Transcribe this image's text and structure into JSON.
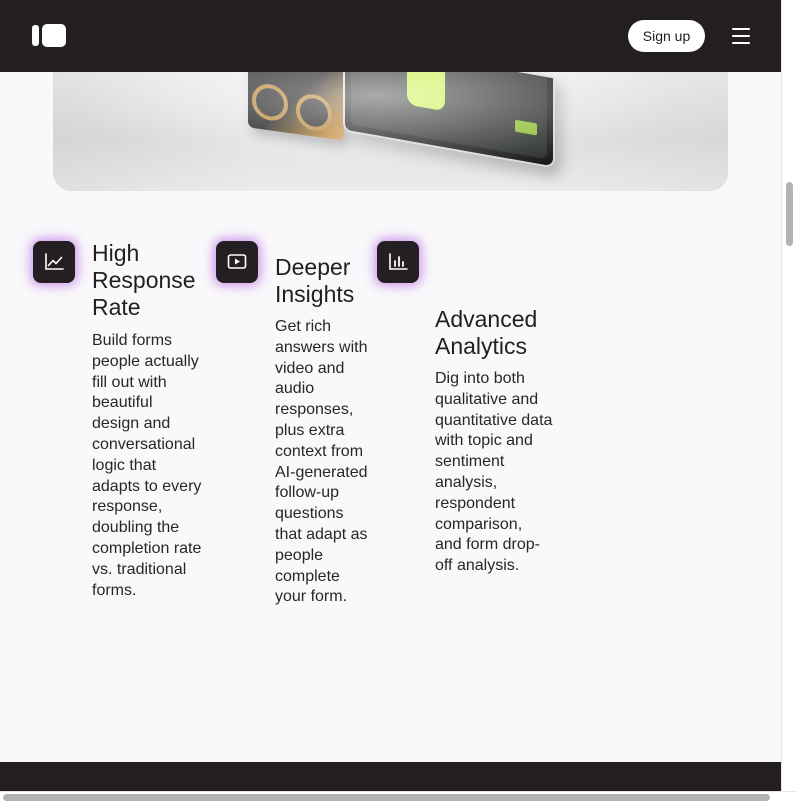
{
  "header": {
    "signup_label": "Sign up"
  },
  "icons": {
    "logo": "logo-icon",
    "menu": "hamburger-menu-icon"
  },
  "features": [
    {
      "icon": "line-chart-icon",
      "title": "High Response Rate",
      "description": "Build forms people actually fill out with beautiful design and conversational logic that adapts to every response, doubling the completion rate vs. traditional forms."
    },
    {
      "icon": "video-play-icon",
      "title": "Deeper Insights",
      "description": "Get rich answers with video and audio responses, plus extra context from AI-generated follow-up questions that adapt as people complete your form."
    },
    {
      "icon": "bar-chart-icon",
      "title": "Advanced Analytics",
      "description": "Dig into both qualitative and quantitative data with topic and sentiment analysis, respondent comparison, and form drop-off analysis."
    }
  ],
  "colors": {
    "header_bg": "#231e22",
    "page_bg": "#f9f8fa",
    "icon_glow": "#aa50e6",
    "text": "#231e22"
  }
}
